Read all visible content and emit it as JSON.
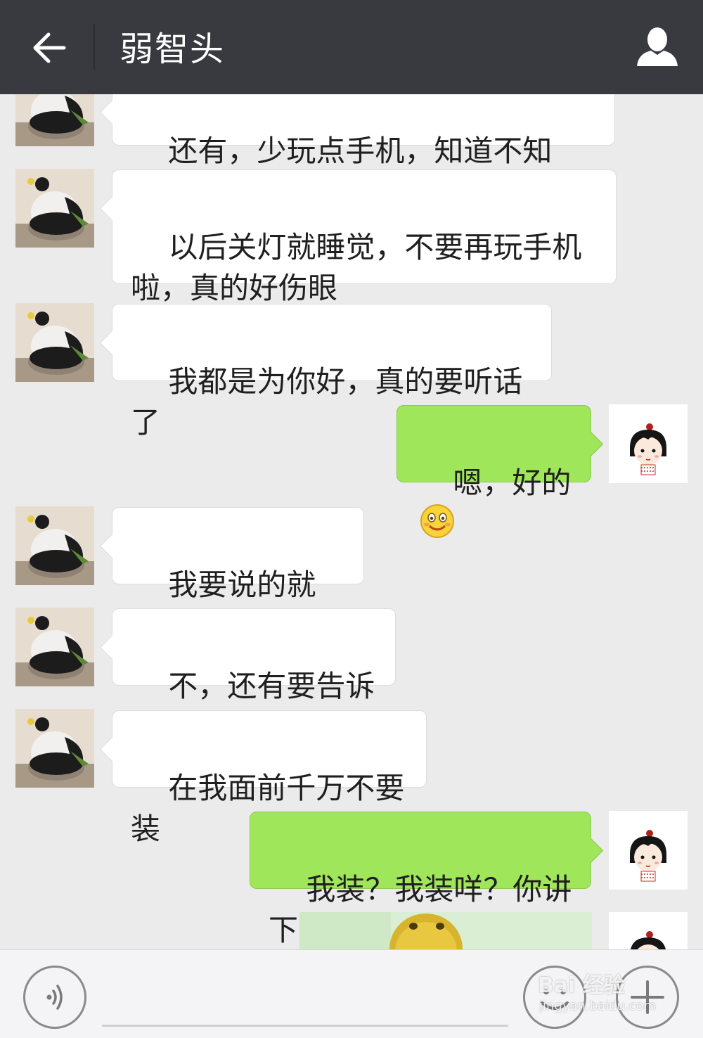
{
  "header": {
    "title": "弱智头",
    "back_icon": "arrow-left-icon",
    "profile_icon": "person-icon"
  },
  "messages": [
    {
      "side": "in",
      "text": "还有，少玩点手机，知道不知道？"
    },
    {
      "side": "in",
      "text": "以后关灯就睡觉，不要再玩手机\n啦，真的好伤眼"
    },
    {
      "side": "in",
      "text": "我都是为你好，真的要听话了"
    },
    {
      "side": "out",
      "text": "嗯，好的",
      "emoji": "smile-emoji-icon"
    },
    {
      "side": "in",
      "text": "我要说的就这些"
    },
    {
      "side": "in",
      "text": "不，还有要告诉你"
    },
    {
      "side": "in",
      "text": "在我面前千万不要装"
    },
    {
      "side": "out",
      "text": "我装？我装咩？你讲下"
    },
    {
      "side": "out",
      "type": "sticker",
      "sticker_icon": "duck-sticker-image"
    }
  ],
  "bottom_bar": {
    "voice_icon": "voice-icon",
    "emoji_icon": "emoji-icon",
    "plus_icon": "plus-icon"
  },
  "watermark": {
    "main": "Bai 经验",
    "sub": "jingyan.baidu.com"
  },
  "colors": {
    "header_bg": "#393a3f",
    "chat_bg": "#ebebeb",
    "incoming_bubble": "#ffffff",
    "outgoing_bubble": "#9fe65b"
  }
}
